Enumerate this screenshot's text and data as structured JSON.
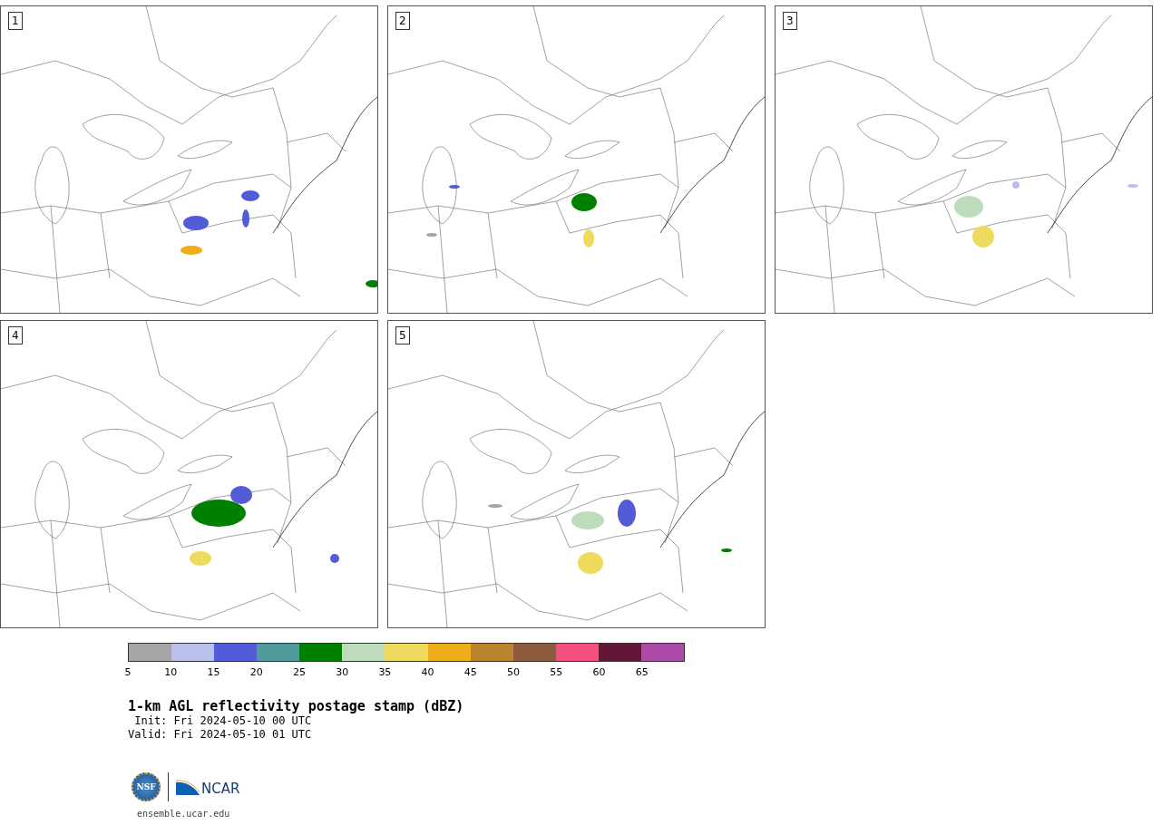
{
  "panels": [
    {
      "label": "1"
    },
    {
      "label": "2"
    },
    {
      "label": "3"
    },
    {
      "label": "4"
    },
    {
      "label": "5"
    }
  ],
  "colorbar": {
    "segments": [
      {
        "color": "#a5a5a5"
      },
      {
        "color": "#b8c1ec"
      },
      {
        "color": "#535bd6"
      },
      {
        "color": "#509a9b"
      },
      {
        "color": "#008000"
      },
      {
        "color": "#bddcbc"
      },
      {
        "color": "#eedb5e"
      },
      {
        "color": "#efae19"
      },
      {
        "color": "#ba8330"
      },
      {
        "color": "#8c5a3d"
      },
      {
        "color": "#f4507e"
      },
      {
        "color": "#621736"
      },
      {
        "color": "#ad4aa8"
      }
    ],
    "ticks": [
      "5",
      "10",
      "15",
      "20",
      "25",
      "30",
      "35",
      "40",
      "45",
      "50",
      "55",
      "60",
      "65"
    ]
  },
  "title": "1-km AGL reflectivity postage stamp (dBZ)",
  "init": " Init: Fri 2024-05-10 00 UTC",
  "valid": "Valid: Fri 2024-05-10 01 UTC",
  "logo": {
    "seal_text": "NSF",
    "wordmark": "NCAR"
  },
  "footer": "ensemble.ucar.edu"
}
